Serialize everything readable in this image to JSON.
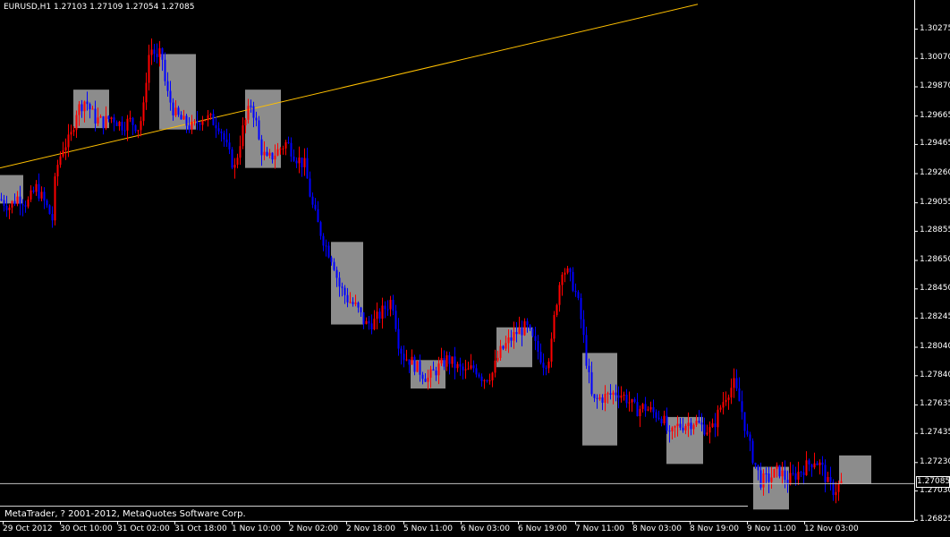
{
  "header": {
    "symbol": "EURUSD,H1",
    "ohlc": "1.27103 1.27109 1.27054 1.27085"
  },
  "footer": {
    "copyright": "MetaTrader, ? 2001-2012, MetaQuotes Software Corp."
  },
  "current_price_label": "1.27085",
  "colors": {
    "background": "#000000",
    "bull_candle": "#ff0000",
    "bear_candle": "#0000ff",
    "box_fill": "#8c8c8c",
    "trendline": "#ffc000",
    "axis": "#ffffff"
  },
  "chart_data": {
    "type": "candlestick",
    "symbol": "EURUSD",
    "timeframe": "H1",
    "ylim": [
      1.2682,
      1.3048
    ],
    "y_ticks": [
      "1.30275",
      "1.30070",
      "1.29870",
      "1.29665",
      "1.29465",
      "1.29260",
      "1.29055",
      "1.28855",
      "1.28650",
      "1.28450",
      "1.28245",
      "1.28040",
      "1.27840",
      "1.27635",
      "1.27435",
      "1.27230",
      "1.27030",
      "1.26825"
    ],
    "x_ticks": [
      "29 Oct 2012",
      "30 Oct 10:00",
      "31 Oct 02:00",
      "31 Oct 18:00",
      "1 Nov 10:00",
      "2 Nov 02:00",
      "2 Nov 18:00",
      "5 Nov 11:00",
      "6 Nov 03:00",
      "6 Nov 19:00",
      "7 Nov 11:00",
      "8 Nov 03:00",
      "8 Nov 19:00",
      "9 Nov 11:00",
      "12 Nov 03:00"
    ],
    "current_price": 1.27085,
    "close_path": [
      [
        0,
        1.2908
      ],
      [
        10,
        1.2903
      ],
      [
        20,
        1.291
      ],
      [
        30,
        1.2905
      ],
      [
        40,
        1.2916
      ],
      [
        50,
        1.2905
      ],
      [
        58,
        1.2894
      ],
      [
        62,
        1.2928
      ],
      [
        70,
        1.2945
      ],
      [
        78,
        1.295
      ],
      [
        85,
        1.297
      ],
      [
        95,
        1.2978
      ],
      [
        105,
        1.2965
      ],
      [
        115,
        1.2962
      ],
      [
        125,
        1.2966
      ],
      [
        135,
        1.296
      ],
      [
        145,
        1.2963
      ],
      [
        155,
        1.2958
      ],
      [
        160,
        1.2972
      ],
      [
        165,
        1.3008
      ],
      [
        170,
        1.3015
      ],
      [
        175,
        1.3005
      ],
      [
        180,
        1.3012
      ],
      [
        185,
        1.2985
      ],
      [
        195,
        1.2968
      ],
      [
        205,
        1.2962
      ],
      [
        215,
        1.2958
      ],
      [
        225,
        1.2966
      ],
      [
        235,
        1.2964
      ],
      [
        245,
        1.296
      ],
      [
        255,
        1.294
      ],
      [
        262,
        1.293
      ],
      [
        270,
        1.2955
      ],
      [
        280,
        1.2975
      ],
      [
        285,
        1.2965
      ],
      [
        290,
        1.2945
      ],
      [
        298,
        1.2935
      ],
      [
        310,
        1.2942
      ],
      [
        320,
        1.2948
      ],
      [
        330,
        1.2938
      ],
      [
        340,
        1.2932
      ],
      [
        348,
        1.2905
      ],
      [
        356,
        1.2888
      ],
      [
        364,
        1.2875
      ],
      [
        372,
        1.2865
      ],
      [
        378,
        1.2848
      ],
      [
        388,
        1.2838
      ],
      [
        398,
        1.2832
      ],
      [
        408,
        1.282
      ],
      [
        418,
        1.2822
      ],
      [
        428,
        1.283
      ],
      [
        438,
        1.2838
      ],
      [
        445,
        1.2808
      ],
      [
        450,
        1.2798
      ],
      [
        458,
        1.2795
      ],
      [
        468,
        1.2788
      ],
      [
        478,
        1.2782
      ],
      [
        490,
        1.279
      ],
      [
        500,
        1.2796
      ],
      [
        510,
        1.279
      ],
      [
        520,
        1.2786
      ],
      [
        530,
        1.279
      ],
      [
        540,
        1.2782
      ],
      [
        550,
        1.2786
      ],
      [
        558,
        1.28
      ],
      [
        568,
        1.2808
      ],
      [
        578,
        1.2815
      ],
      [
        588,
        1.2818
      ],
      [
        598,
        1.2805
      ],
      [
        608,
        1.2792
      ],
      [
        615,
        1.28
      ],
      [
        620,
        1.283
      ],
      [
        628,
        1.286
      ],
      [
        635,
        1.2855
      ],
      [
        640,
        1.2848
      ],
      [
        645,
        1.2838
      ],
      [
        650,
        1.282
      ],
      [
        655,
        1.2795
      ],
      [
        662,
        1.2765
      ],
      [
        670,
        1.2768
      ],
      [
        680,
        1.277
      ],
      [
        690,
        1.2773
      ],
      [
        700,
        1.2768
      ],
      [
        710,
        1.276
      ],
      [
        720,
        1.2762
      ],
      [
        730,
        1.2758
      ],
      [
        740,
        1.2755
      ],
      [
        748,
        1.274
      ],
      [
        755,
        1.2748
      ],
      [
        765,
        1.275
      ],
      [
        775,
        1.2752
      ],
      [
        785,
        1.2748
      ],
      [
        795,
        1.2745
      ],
      [
        805,
        1.2762
      ],
      [
        812,
        1.2772
      ],
      [
        820,
        1.2778
      ],
      [
        828,
        1.2762
      ],
      [
        835,
        1.274
      ],
      [
        842,
        1.2725
      ],
      [
        850,
        1.271
      ],
      [
        860,
        1.2712
      ],
      [
        870,
        1.2718
      ],
      [
        880,
        1.271
      ],
      [
        890,
        1.2715
      ],
      [
        900,
        1.272
      ],
      [
        910,
        1.2725
      ],
      [
        918,
        1.272
      ],
      [
        925,
        1.2708
      ],
      [
        932,
        1.2703
      ],
      [
        938,
        1.2708
      ],
      [
        942,
        1.27085
      ]
    ],
    "trendline": [
      [
        0,
        1.293
      ],
      [
        780,
        1.3045
      ]
    ],
    "boxes": [
      [
        0,
        26,
        1.2905,
        1.2925
      ],
      [
        82,
        122,
        1.2958,
        1.2985
      ],
      [
        178,
        219,
        1.2957,
        1.301
      ],
      [
        274,
        314,
        1.293,
        1.2985
      ],
      [
        370,
        406,
        1.282,
        1.2878
      ],
      [
        459,
        498,
        1.2775,
        1.2795
      ],
      [
        555,
        595,
        1.279,
        1.2818
      ],
      [
        651,
        690,
        1.2735,
        1.28
      ],
      [
        745,
        786,
        1.2722,
        1.2755
      ],
      [
        842,
        882,
        1.269,
        1.272
      ],
      [
        938,
        974,
        1.2708,
        1.2728
      ]
    ]
  }
}
